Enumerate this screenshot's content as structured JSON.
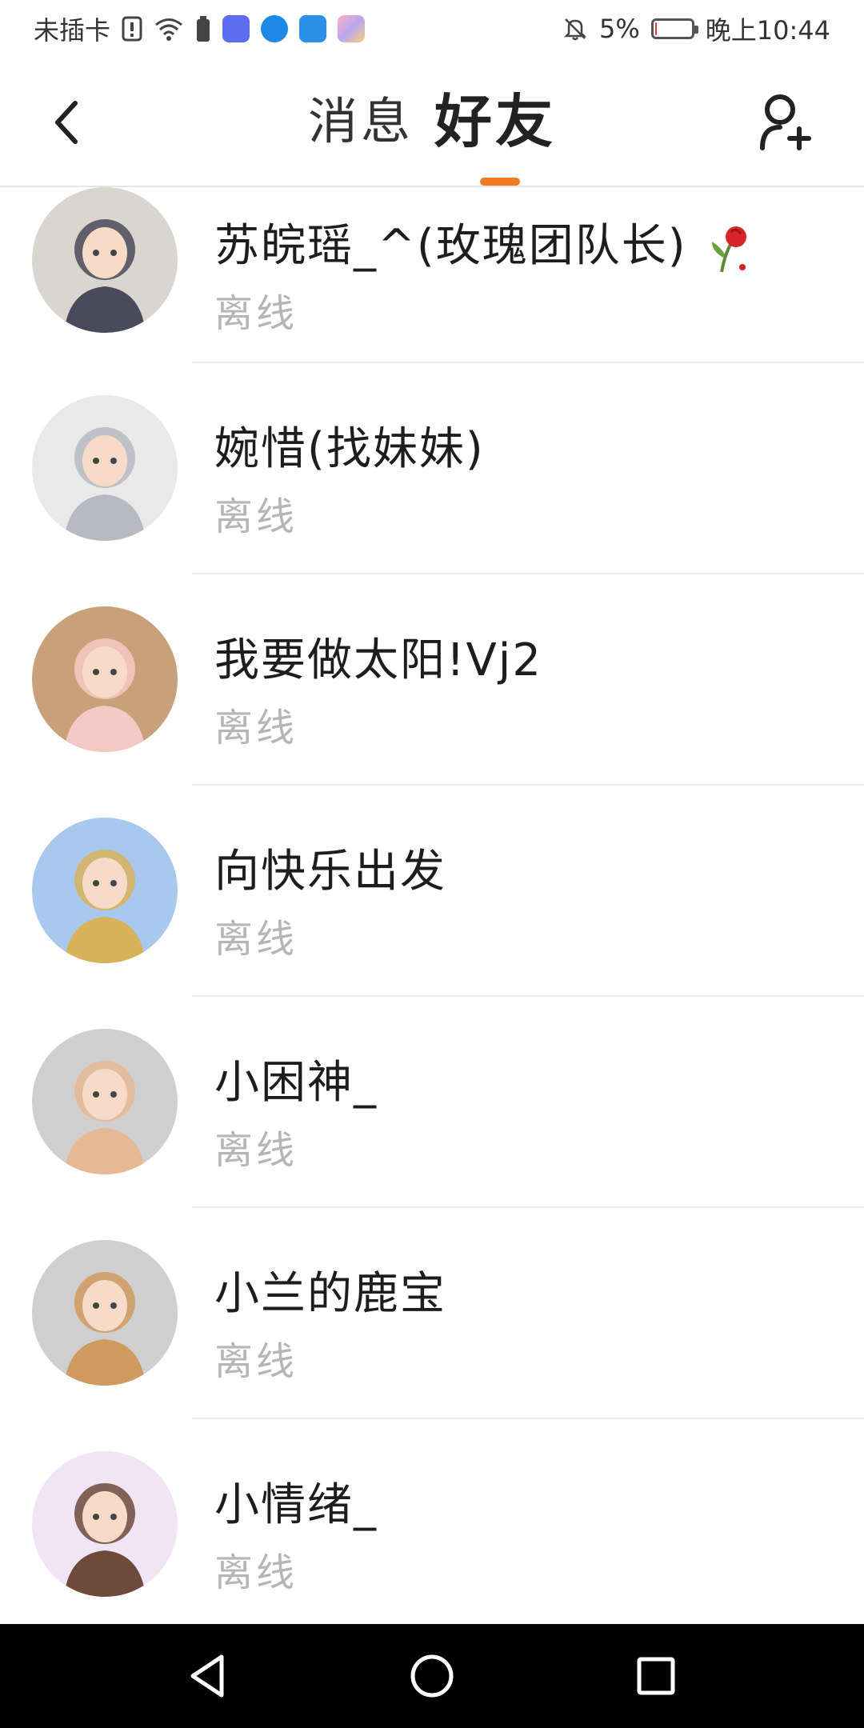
{
  "status_bar": {
    "carrier": "未插卡",
    "battery_percent": "5%",
    "battery_level": 0.05,
    "time": "晚上10:44",
    "icons": [
      "sim-alert-icon",
      "wifi-icon",
      "battery-saver-icon",
      "music-app-icon",
      "browser-app-icon",
      "weather-app-icon",
      "gallery-app-icon",
      "mute-icon"
    ]
  },
  "header": {
    "tabs": [
      {
        "label": "消息",
        "active": false
      },
      {
        "label": "好友",
        "active": true
      }
    ],
    "accent_color": "#f07b22"
  },
  "friends": [
    {
      "name": "苏皖瑶_^(玫瑰团队长)",
      "status": "离线",
      "avatar_colors": [
        "#d9d6d0",
        "#4a4a5a"
      ]
    },
    {
      "name": "婉惜(找妹妹)",
      "status": "离线",
      "avatar_colors": [
        "#e9e9ea",
        "#b9b9c3"
      ]
    },
    {
      "name": "我要做太阳!Vj2",
      "status": "离线",
      "avatar_colors": [
        "#c8a07a",
        "#f3c9c6"
      ]
    },
    {
      "name": "向快乐出发",
      "status": "离线",
      "avatar_colors": [
        "#a9c8ee",
        "#d8b15a"
      ]
    },
    {
      "name": "小困神_",
      "status": "离线",
      "avatar_colors": [
        "#cfcfcf",
        "#e6b894"
      ]
    },
    {
      "name": "小兰的鹿宝",
      "status": "离线",
      "avatar_colors": [
        "#cfcfcf",
        "#cf9a5e"
      ]
    },
    {
      "name": "小情绪_",
      "status": "离线",
      "avatar_colors": [
        "#f1e4f4",
        "#6e4a3a"
      ]
    }
  ]
}
